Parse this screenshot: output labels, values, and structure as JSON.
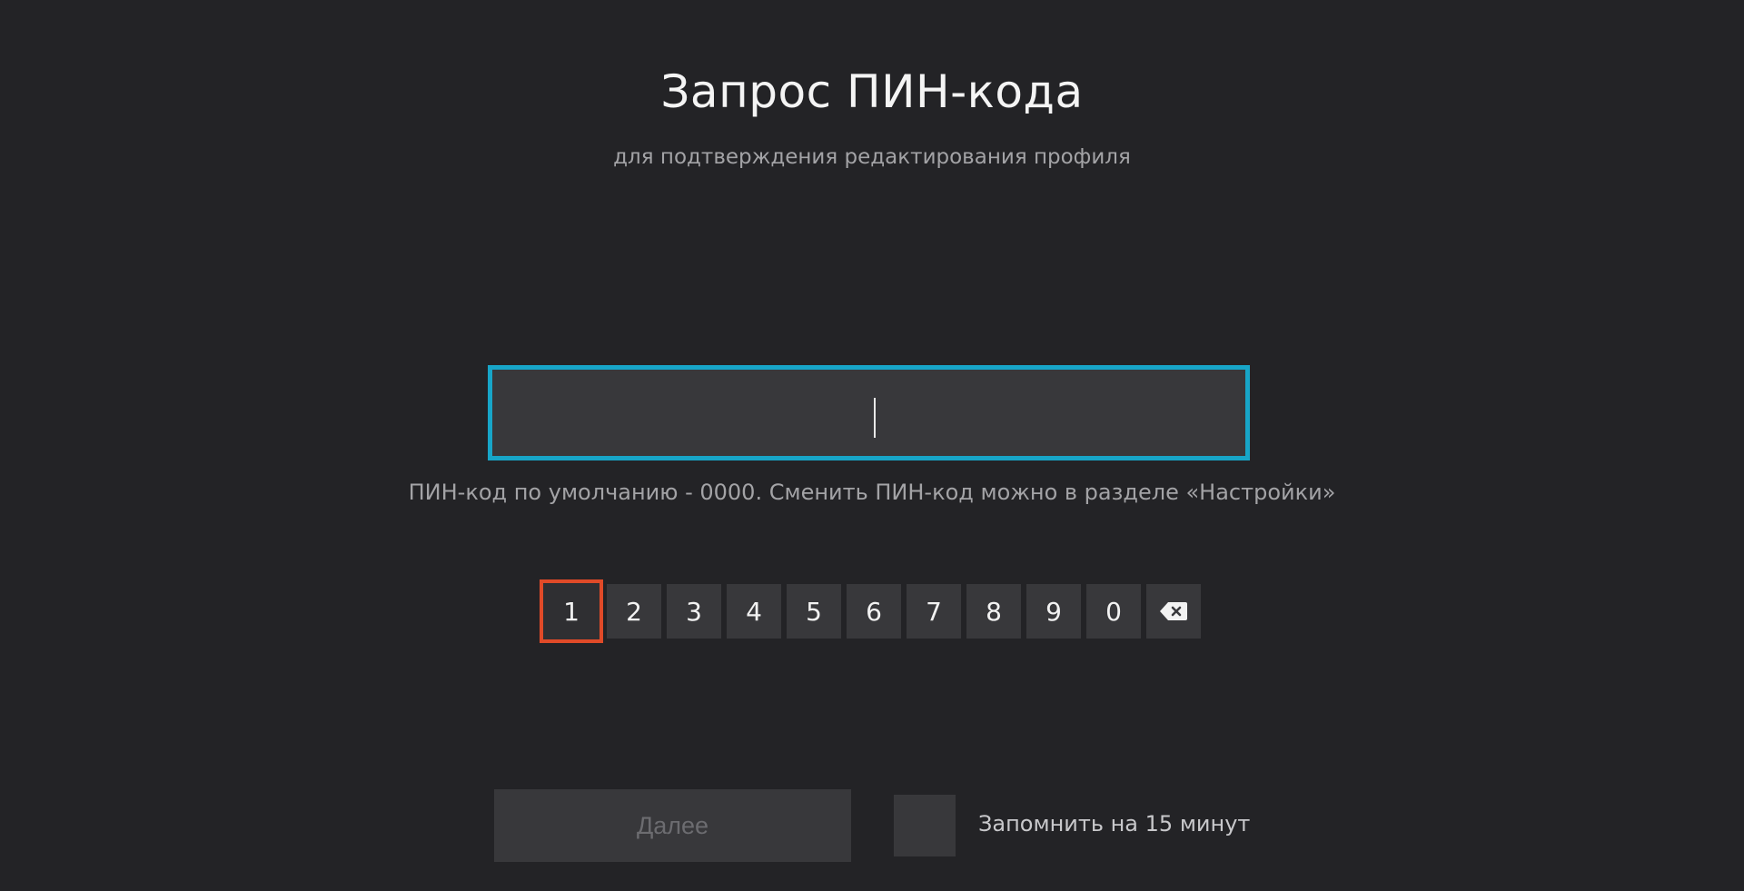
{
  "header": {
    "title": "Запрос ПИН-кода",
    "subtitle": "для подтверждения редактирования профиля"
  },
  "pin_field": {
    "value": "",
    "focused": true
  },
  "hint": "ПИН-код по умолчанию - 0000. Сменить ПИН-код можно в разделе «Настройки»",
  "keypad": {
    "keys": [
      "1",
      "2",
      "3",
      "4",
      "5",
      "6",
      "7",
      "8",
      "9",
      "0"
    ],
    "focused_key": "1",
    "backspace_icon": "backspace-icon"
  },
  "footer": {
    "next_label": "Далее",
    "remember_label": "Запомнить на 15 минут",
    "remember_checked": false
  },
  "colors": {
    "background": "#232326",
    "input_focus_border": "#17a5c8",
    "key_focus_border": "#e04a28",
    "control_fill": "#38383b"
  }
}
